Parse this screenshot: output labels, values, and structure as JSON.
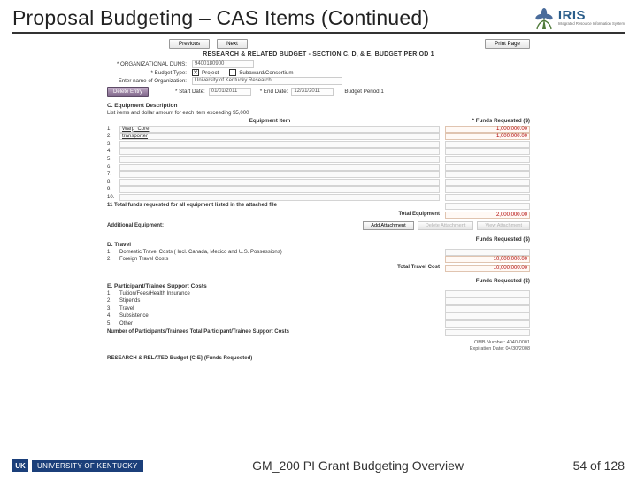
{
  "header": {
    "title": "Proposal Budgeting – CAS Items (Continued)",
    "logo_word": "IRIS",
    "logo_sub": "Integrated Resource Information System"
  },
  "nav": {
    "prev": "Previous",
    "next": "Next",
    "print": "Print Page"
  },
  "form": {
    "title": "RESEARCH & RELATED BUDGET - SECTION C, D, & E, BUDGET PERIOD 1",
    "org_duns_label": "ORGANIZATIONAL DUNS:",
    "org_duns_value": "9400180900",
    "budget_type_label": "Budget Type:",
    "project_label": "Project",
    "subaward_label": "Subaward/Consortium",
    "org_name_label": "Enter name of Organization:",
    "org_name_value": "University of Kentucky Research",
    "delete_btn": "Delete Entry",
    "start_label": "Start Date:",
    "start_value": "01/01/2011",
    "end_label": "End Date:",
    "end_value": "12/31/2011",
    "period_label": "Budget Period 1"
  },
  "sectionC": {
    "header": "C. Equipment Description",
    "subtext": "List items and dollar amount for each item exceeding $5,000",
    "col_item": "Equipment Item",
    "col_funds": "* Funds Requested ($)",
    "rows": [
      {
        "n": "1.",
        "name": "Warp_Core",
        "amt": "1,000,000.00"
      },
      {
        "n": "2.",
        "name": "transporter",
        "amt": "1,000,000.00"
      },
      {
        "n": "3.",
        "name": "",
        "amt": ""
      },
      {
        "n": "4.",
        "name": "",
        "amt": ""
      },
      {
        "n": "5.",
        "name": "",
        "amt": ""
      },
      {
        "n": "6.",
        "name": "",
        "amt": ""
      },
      {
        "n": "7.",
        "name": "",
        "amt": ""
      },
      {
        "n": "8.",
        "name": "",
        "amt": ""
      },
      {
        "n": "9.",
        "name": "",
        "amt": ""
      },
      {
        "n": "10.",
        "name": "",
        "amt": ""
      }
    ],
    "total_line_left": "11  Total funds requested for all equipment listed in the attached file",
    "total_eq_label": "Total Equipment",
    "total_eq_value": "2,000,000.00",
    "attach_label": "Additional Equipment:",
    "btn_add": "Add Attachment",
    "btn_del": "Delete Attachment",
    "btn_view": "View Attachment"
  },
  "sectionD": {
    "header": "D. Travel",
    "col_funds": "Funds Requested ($)",
    "rows": [
      {
        "n": "1.",
        "label": "Domestic Travel Costs ( Incl. Canada, Mexico and U.S. Possessions)",
        "amt": ""
      },
      {
        "n": "2.",
        "label": "Foreign Travel Costs",
        "amt": "10,000,000.00"
      }
    ],
    "total_label": "Total Travel Cost",
    "total_value": "10,000,000.00"
  },
  "sectionE": {
    "header": "E. Participant/Trainee Support Costs",
    "col_funds": "Funds Requested ($)",
    "rows": [
      {
        "n": "1.",
        "label": "Tuition/Fees/Health Insurance"
      },
      {
        "n": "2.",
        "label": "Stipends"
      },
      {
        "n": "3.",
        "label": "Travel"
      },
      {
        "n": "4.",
        "label": "Subsistence"
      },
      {
        "n": "5.",
        "label": "Other"
      }
    ],
    "footer_line": "Number of Participants/Trainees      Total Participant/Trainee Support Costs"
  },
  "form_meta": {
    "omb": "OMB Number: 4040-0001",
    "exp": "Expiration Date: 04/30/2008"
  },
  "form_num": "RESEARCH & RELATED Budget {C-E} (Funds Requested)",
  "footer": {
    "uk": "UNIVERSITY OF KENTUCKY",
    "center": "GM_200 PI Grant Budgeting Overview",
    "page": "54 of 128"
  }
}
